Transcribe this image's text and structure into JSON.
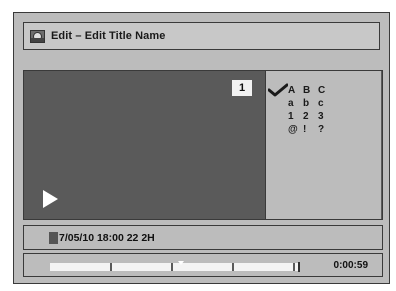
{
  "header": {
    "title": "Edit – Edit Title Name",
    "icon": "disc-edit-icon"
  },
  "preview": {
    "title_number": "1",
    "play_icon": "play-icon"
  },
  "character_sets": {
    "rows": [
      [
        "A",
        "B",
        "C"
      ],
      [
        "a",
        "b",
        "c"
      ],
      [
        "1",
        "2",
        "3"
      ],
      [
        "@",
        "!",
        "?"
      ]
    ],
    "selected_row": 0,
    "selection_icon": "check-icon"
  },
  "info": {
    "text": "7/05/10  18:00  22  2H",
    "rec_icon": "record-box-icon"
  },
  "progress": {
    "time": "0:00:59",
    "marker_fraction": 0.53
  }
}
